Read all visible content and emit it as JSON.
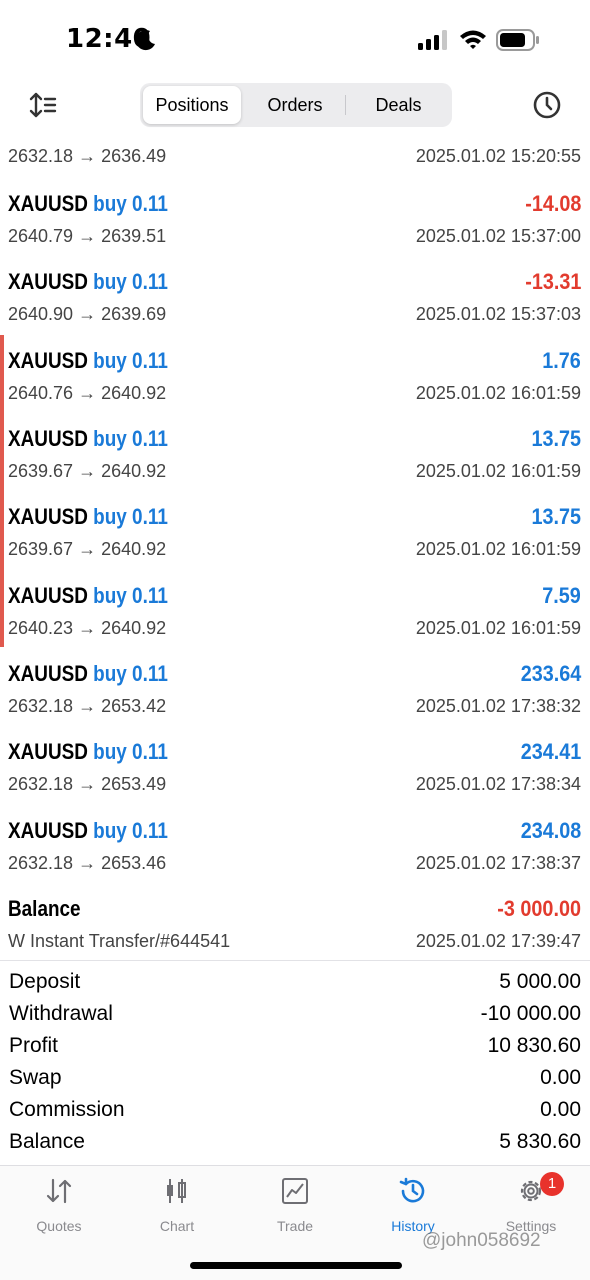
{
  "status_bar": {
    "time": "12:40"
  },
  "tabs": [
    {
      "label": "Positions",
      "active": true
    },
    {
      "label": "Orders",
      "active": false
    },
    {
      "label": "Deals",
      "active": false
    }
  ],
  "partial_row": {
    "prices": "2632.18 → 2636.49",
    "time": "2025.01.02 15:20:55"
  },
  "rows": [
    {
      "symbol": "XAUUSD",
      "type": "buy 0.11",
      "amount": "-14.08",
      "prices": "2640.79 → 2639.51",
      "time": "2025.01.02 15:37:00"
    },
    {
      "symbol": "XAUUSD",
      "type": "buy 0.11",
      "amount": "-13.31",
      "prices": "2640.90 → 2639.69",
      "time": "2025.01.02 15:37:03"
    },
    {
      "symbol": "XAUUSD",
      "type": "buy 0.11",
      "amount": "1.76",
      "prices": "2640.76 → 2640.92",
      "time": "2025.01.02 16:01:59"
    },
    {
      "symbol": "XAUUSD",
      "type": "buy 0.11",
      "amount": "13.75",
      "prices": "2639.67 → 2640.92",
      "time": "2025.01.02 16:01:59"
    },
    {
      "symbol": "XAUUSD",
      "type": "buy 0.11",
      "amount": "13.75",
      "prices": "2639.67 → 2640.92",
      "time": "2025.01.02 16:01:59"
    },
    {
      "symbol": "XAUUSD",
      "type": "buy 0.11",
      "amount": "7.59",
      "prices": "2640.23 → 2640.92",
      "time": "2025.01.02 16:01:59"
    },
    {
      "symbol": "XAUUSD",
      "type": "buy 0.11",
      "amount": "233.64",
      "prices": "2632.18 → 2653.42",
      "time": "2025.01.02 17:38:32"
    },
    {
      "symbol": "XAUUSD",
      "type": "buy 0.11",
      "amount": "234.41",
      "prices": "2632.18 → 2653.49",
      "time": "2025.01.02 17:38:34"
    },
    {
      "symbol": "XAUUSD",
      "type": "buy 0.11",
      "amount": "234.08",
      "prices": "2632.18 → 2653.46",
      "time": "2025.01.02 17:38:37"
    }
  ],
  "balance_row": {
    "label": "Balance",
    "amount": "-3 000.00",
    "comment": "W Instant Transfer/#644541",
    "time": "2025.01.02 17:39:47"
  },
  "summary": [
    {
      "label": "Deposit",
      "value": "5 000.00"
    },
    {
      "label": "Withdrawal",
      "value": "-10 000.00"
    },
    {
      "label": "Profit",
      "value": "10 830.60"
    },
    {
      "label": "Swap",
      "value": "0.00"
    },
    {
      "label": "Commission",
      "value": "0.00"
    },
    {
      "label": "Balance",
      "value": "5 830.60"
    }
  ],
  "bottom_nav": [
    {
      "label": "Quotes",
      "icon": "quotes-icon"
    },
    {
      "label": "Chart",
      "icon": "chart-icon"
    },
    {
      "label": "Trade",
      "icon": "trade-icon"
    },
    {
      "label": "History",
      "icon": "history-icon",
      "active": true
    },
    {
      "label": "Settings",
      "icon": "settings-icon",
      "badge": "1"
    }
  ],
  "watermark": "@john058692",
  "colors": {
    "accent": "#1a7ad8",
    "negative": "#e23b2e",
    "marker": "#e0594e"
  }
}
